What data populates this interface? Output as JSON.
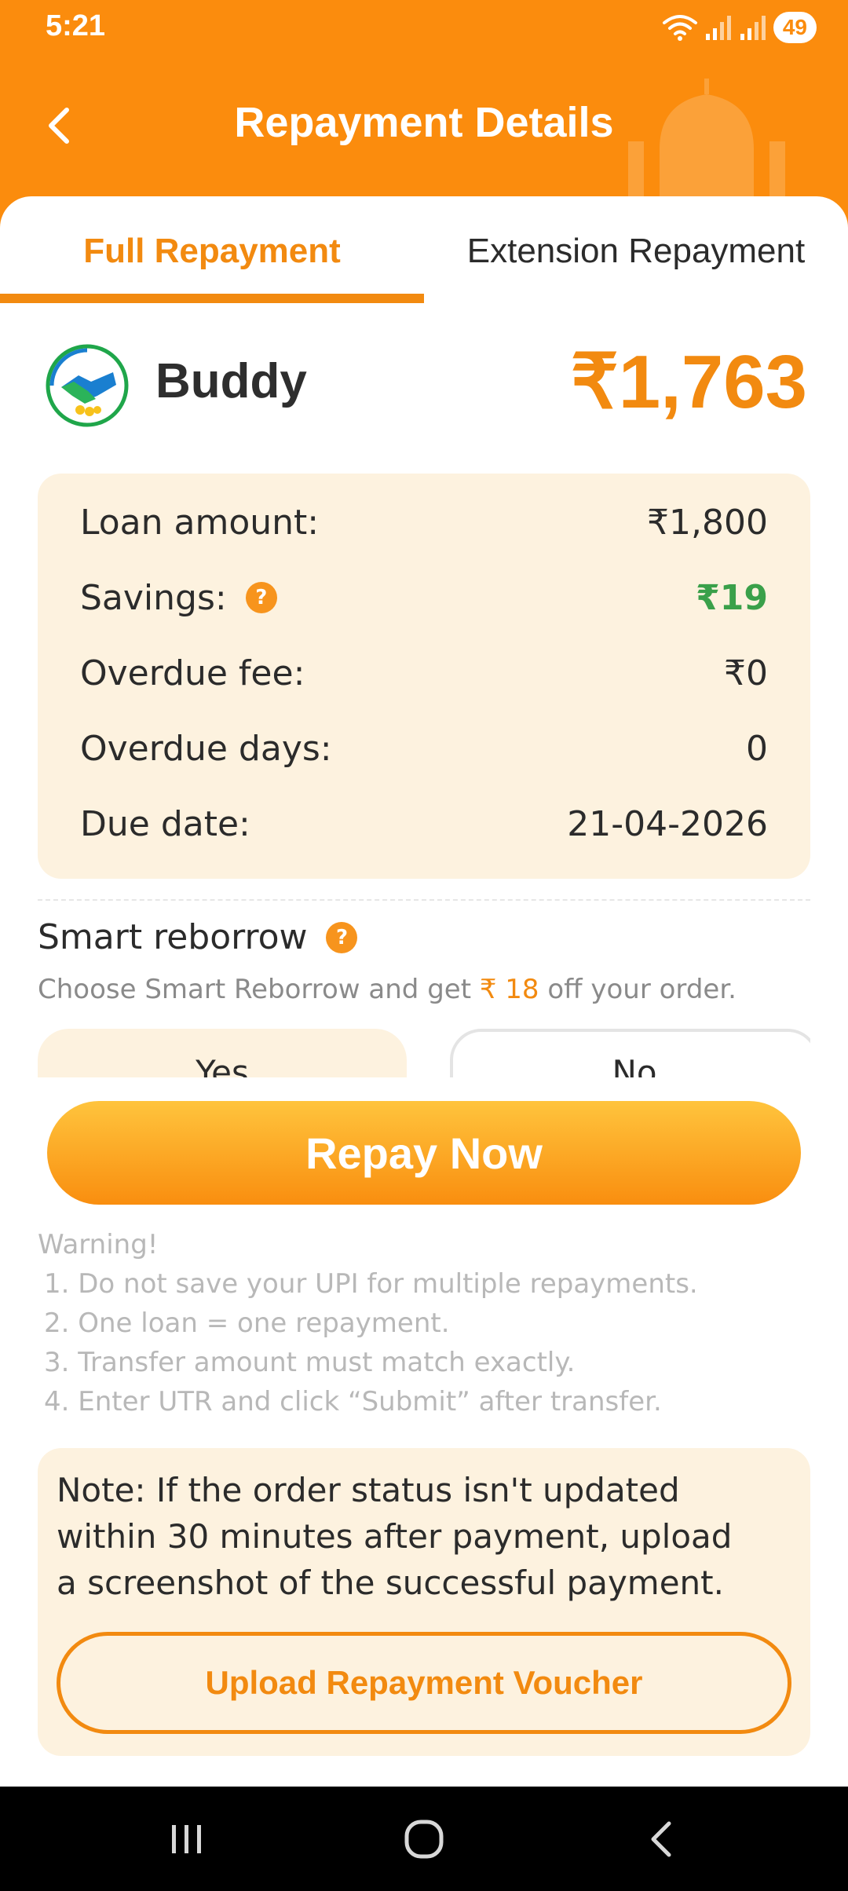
{
  "status_bar": {
    "time": "5:21",
    "battery": "49"
  },
  "header": {
    "title": "Repayment Details"
  },
  "tabs": [
    {
      "label": "Full Repayment",
      "active": true
    },
    {
      "label": "Extension Repayment",
      "active": false
    }
  ],
  "brand": {
    "name": "Buddy",
    "amount": "₹1,763"
  },
  "details": [
    {
      "label": "Loan amount:",
      "value": "₹1,800"
    },
    {
      "label": "Savings:",
      "value": "₹19"
    },
    {
      "label": "Overdue fee:",
      "value": "₹0"
    },
    {
      "label": "Overdue days:",
      "value": "0"
    },
    {
      "label": "Due date:",
      "value": "21-04-2026"
    }
  ],
  "smart_reborrow": {
    "title": "Smart reborrow",
    "sub_prefix": "Choose Smart Reborrow and get ",
    "sub_accent": "₹ 18",
    "sub_suffix": " off your order.",
    "yes_label": "Yes",
    "no_label": "No"
  },
  "repay_button": "Repay Now",
  "warning": {
    "title": "Warning!",
    "items": [
      "1. Do not save your UPI for multiple repayments.",
      "2. One loan = one repayment.",
      "3. Transfer amount must match exactly.",
      "4. Enter UTR and click “Submit” after transfer."
    ]
  },
  "note": {
    "text": "Note: If the order status isn't updated within 30 minutes after payment, upload a screenshot of the successful payment.",
    "upload_button": "Upload Repayment Voucher"
  },
  "help_glyph": "?",
  "colors": {
    "brand_orange": "#fb8c0d",
    "accent": "#f28a10",
    "savings_green": "#3aa04a",
    "panel_bg": "#fdf2df"
  },
  "icons": {
    "back": "chevron-left-icon",
    "wifi": "wifi-icon",
    "signal": "signal-icon",
    "help": "question-circle-icon",
    "nav_recents": "recents-icon",
    "nav_home": "home-icon",
    "nav_back": "back-icon"
  }
}
